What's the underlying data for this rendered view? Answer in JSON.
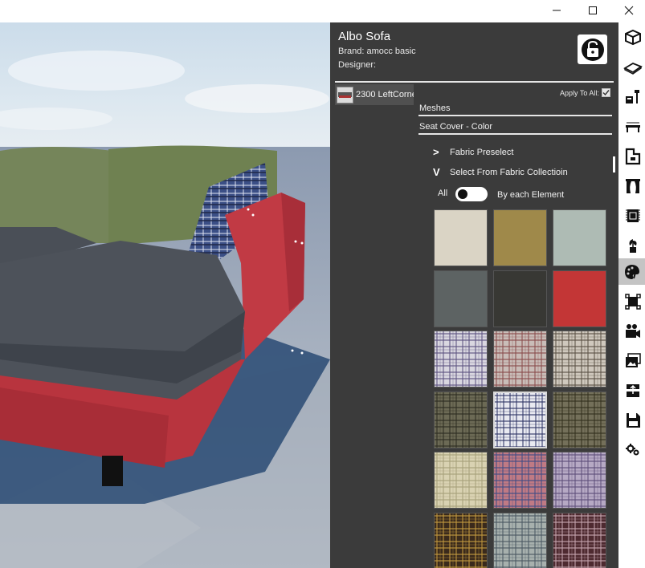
{
  "window": {
    "controls": {
      "minimize_icon": "minimize-icon",
      "maximize_icon": "maximize-icon",
      "close_icon": "close-icon"
    }
  },
  "panel": {
    "title": "Albo Sofa",
    "brand": "Brand: amocc basic",
    "designer": "Designer:",
    "lock_icon": "unlock-icon",
    "mesh_item": "2300 LeftCorne",
    "apply_to_all": "Apply To All:",
    "apply_to_all_checked": true,
    "section_meshes": "Meshes",
    "section_seat": "Seat Cover - Color",
    "fabric_preselect_chevron": ">",
    "fabric_preselect": "Fabric Preselect",
    "fabric_collection_chevron": "V",
    "fabric_collection": "Select From Fabric Collectioin",
    "toggle_left": "All",
    "toggle_right": "By each Element",
    "toggle_on": false
  },
  "swatches": [
    {
      "kind": "solid",
      "color": "#e8e2d2"
    },
    {
      "kind": "solid",
      "color": "#a9924f"
    },
    {
      "kind": "solid",
      "color": "#b9c7c0"
    },
    {
      "kind": "solid",
      "color": "#636a6a"
    },
    {
      "kind": "solid",
      "color": "#3c3c38"
    },
    {
      "kind": "solid",
      "color": "#d03a3a"
    },
    {
      "kind": "plaid",
      "base": "#d9d7e0",
      "line": "#5d5480"
    },
    {
      "kind": "plaid",
      "base": "#c9bdb8",
      "line": "#8a4c4c"
    },
    {
      "kind": "plaid",
      "base": "#cfc8bd",
      "line": "#5b5246"
    },
    {
      "kind": "plaid",
      "base": "#6c6a55",
      "line": "#2e2d22"
    },
    {
      "kind": "plaid",
      "base": "#e9eaf1",
      "line": "#2f3566",
      "selected": true
    },
    {
      "kind": "plaid",
      "base": "#74705a",
      "line": "#33311f"
    },
    {
      "kind": "plaid",
      "base": "#d9d2b2",
      "line": "#a7a07b"
    },
    {
      "kind": "plaid",
      "base": "#c07a84",
      "line": "#3f4c86"
    },
    {
      "kind": "plaid",
      "base": "#b6a9c4",
      "line": "#5e4f7a"
    },
    {
      "kind": "plaid",
      "base": "#3a2a1c",
      "line": "#c39a40"
    },
    {
      "kind": "plaid",
      "base": "#a7b0ad",
      "line": "#4b5963"
    },
    {
      "kind": "plaid",
      "base": "#4e2a30",
      "line": "#c6a6b0"
    }
  ],
  "toolbar": [
    {
      "icon": "cube-view-icon"
    },
    {
      "icon": "floor-plane-icon"
    },
    {
      "icon": "lamp-furniture-icon"
    },
    {
      "icon": "table-icon"
    },
    {
      "icon": "floorplan-icon"
    },
    {
      "icon": "curtain-icon"
    },
    {
      "icon": "rug-icon"
    },
    {
      "icon": "plant-icon"
    },
    {
      "icon": "material-palette-icon",
      "active": true
    },
    {
      "icon": "object-select-icon"
    },
    {
      "icon": "video-camera-icon"
    },
    {
      "icon": "image-gallery-icon"
    },
    {
      "icon": "export-icon"
    },
    {
      "icon": "save-icon"
    },
    {
      "icon": "settings-gears-icon"
    }
  ]
}
